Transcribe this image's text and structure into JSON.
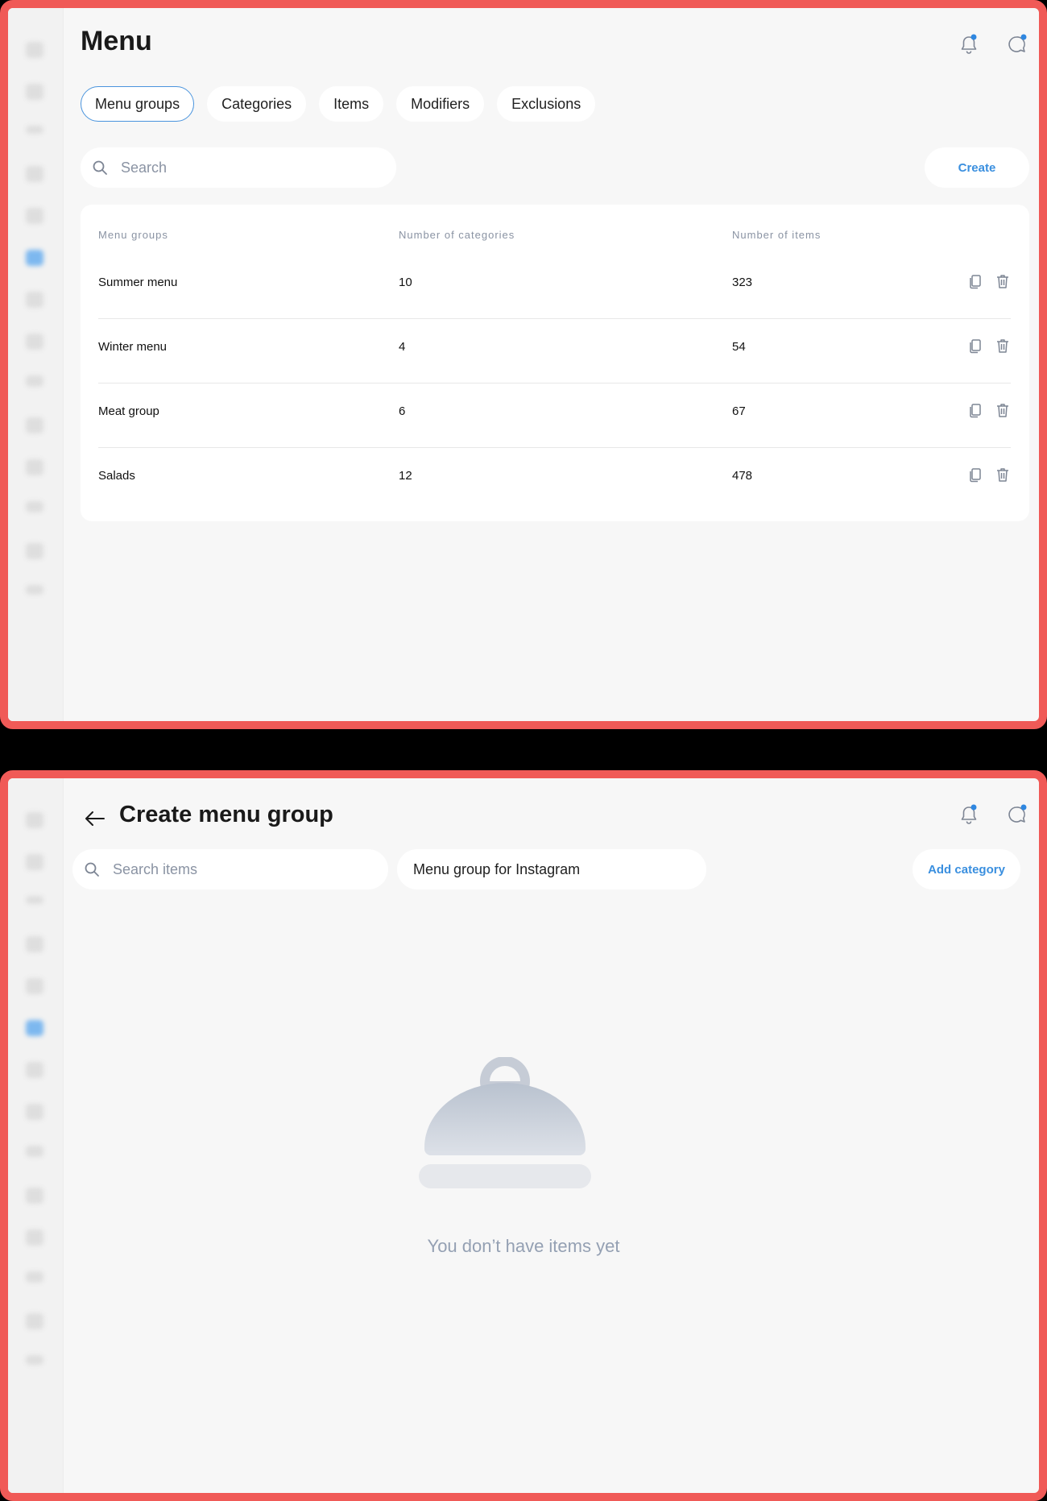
{
  "colors": {
    "frame_border": "#f05a57",
    "accent": "#3a8fdf",
    "background": "#f7f7f7",
    "muted_text": "#8a93a3"
  },
  "sidebar": {
    "icons": [
      "menu-icon",
      "dashboard-icon",
      "orders-icon",
      "support-icon",
      "search-icon",
      "menu-active-icon",
      "users-icon",
      "chat-icon",
      "analytics-icon",
      "document-icon",
      "report-icon",
      "settings-icon",
      "support-icon",
      "more-icon"
    ]
  },
  "screen1": {
    "title": "Menu",
    "tabs": [
      {
        "label": "Menu groups",
        "active": true
      },
      {
        "label": "Categories",
        "active": false
      },
      {
        "label": "Items",
        "active": false
      },
      {
        "label": "Modifiers",
        "active": false
      },
      {
        "label": "Exclusions",
        "active": false
      }
    ],
    "search_placeholder": "Search",
    "create_label": "Create",
    "table": {
      "headers": [
        "Menu groups",
        "Number of categories",
        "Number of items"
      ],
      "rows": [
        {
          "name": "Summer menu",
          "categories": "10",
          "items": "323"
        },
        {
          "name": "Winter menu",
          "categories": "4",
          "items": "54"
        },
        {
          "name": "Meat group",
          "categories": "6",
          "items": "67"
        },
        {
          "name": "Salads",
          "categories": "12",
          "items": "478"
        }
      ]
    }
  },
  "screen2": {
    "title": "Create menu group",
    "search_placeholder": "Search items",
    "name_value": "Menu group for Instagram",
    "add_category_label": "Add category",
    "empty_message": "You don’t have items yet"
  }
}
